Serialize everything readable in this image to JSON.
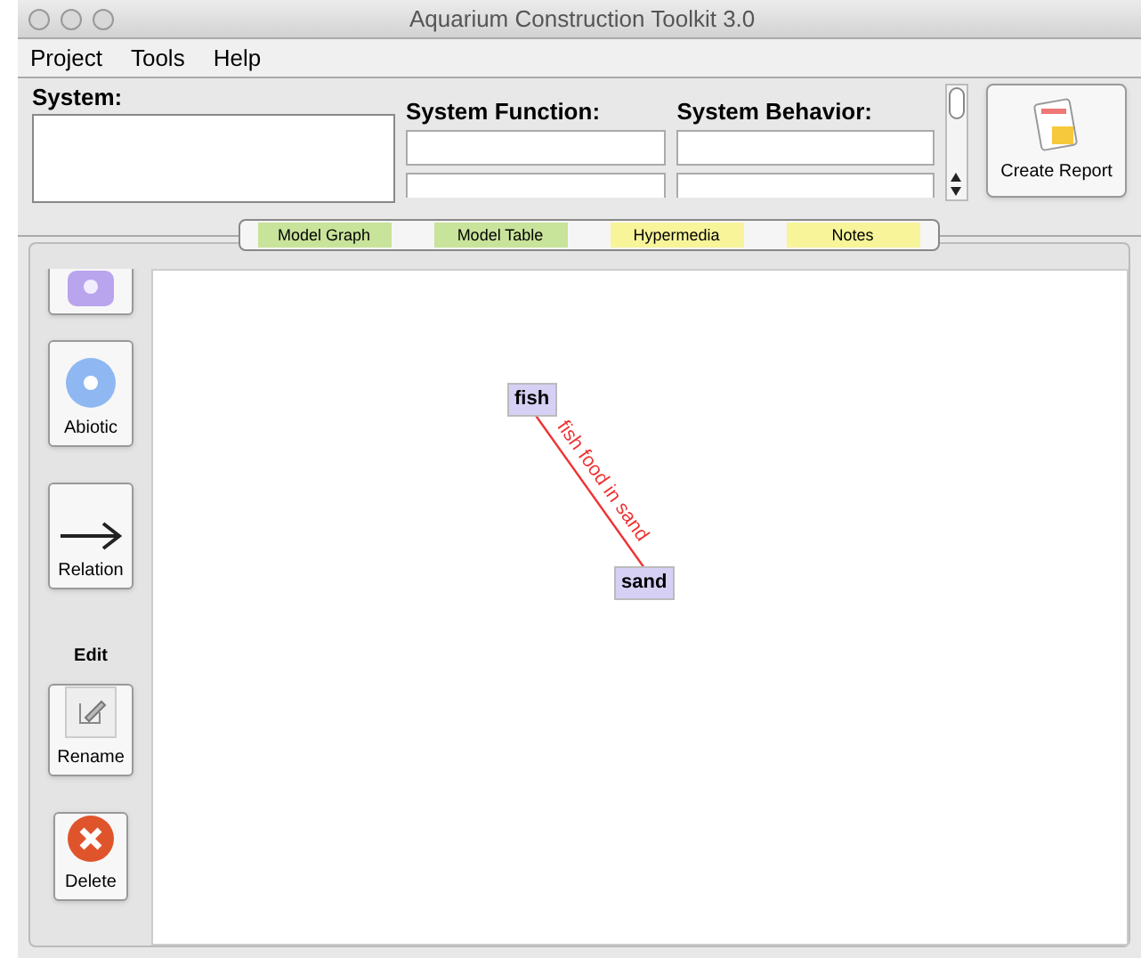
{
  "window": {
    "title": "Aquarium Construction Toolkit 3.0"
  },
  "menu": [
    "Project",
    "Tools",
    "Help"
  ],
  "system": {
    "label": "System:"
  },
  "function": {
    "label": "System Function:"
  },
  "behavior": {
    "label": "System Behavior:"
  },
  "report_button": {
    "label": "Create Report"
  },
  "tabs": [
    {
      "label": "Model Graph",
      "color": "#c8e39a"
    },
    {
      "label": "Model Table",
      "color": "#c8e39a"
    },
    {
      "label": "Hypermedia",
      "color": "#f7f49a"
    },
    {
      "label": "Notes",
      "color": "#f7f49a"
    }
  ],
  "tools": [
    {
      "kind": "purple-node"
    },
    {
      "kind": "blue-node",
      "label": "Abiotic"
    },
    {
      "kind": "arrow",
      "label": "Relation"
    },
    {
      "kind": "heading",
      "label": "Edit"
    },
    {
      "kind": "pencil",
      "label": "Rename"
    },
    {
      "kind": "delete",
      "label": "Delete"
    }
  ],
  "graph": {
    "nodes": [
      {
        "label": "fish"
      },
      {
        "label": "sand"
      }
    ],
    "relations": [
      {
        "label": "fish food in sand"
      }
    ]
  }
}
